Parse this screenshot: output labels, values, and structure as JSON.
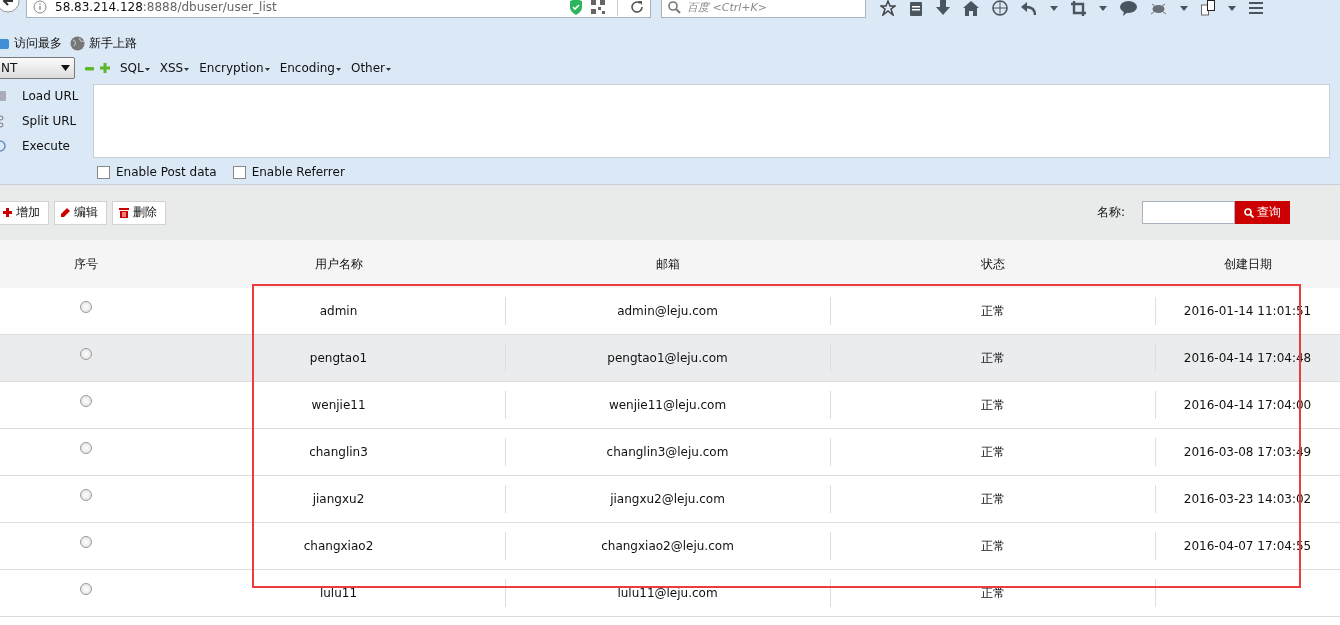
{
  "browser": {
    "url_host": "58.83.214.128",
    "url_rest": ":8888/dbuser/user_list",
    "search_placeholder": "百度 <Ctrl+K>"
  },
  "bookmarks": [
    {
      "label": "访问最多"
    },
    {
      "label": "新手上路"
    }
  ],
  "hackbar": {
    "select_value": "NT",
    "menus": [
      "SQL",
      "XSS",
      "Encryption",
      "Encoding",
      "Other"
    ],
    "actions": [
      {
        "label": "Load URL"
      },
      {
        "label": "Split URL"
      },
      {
        "label": "Execute"
      }
    ],
    "options": [
      {
        "label": "Enable Post data",
        "checked": false
      },
      {
        "label": "Enable Referrer",
        "checked": false
      }
    ]
  },
  "toolbar": {
    "buttons": [
      {
        "kind": "add",
        "label": "增加"
      },
      {
        "kind": "edit",
        "label": "编辑"
      },
      {
        "kind": "delete",
        "label": "删除"
      }
    ],
    "search_label": "名称:",
    "search_button": "查询"
  },
  "table": {
    "columns": [
      "序号",
      "用户名称",
      "邮箱",
      "状态",
      "创建日期"
    ],
    "rows": [
      {
        "selected": false,
        "name": "admin",
        "email": "admin@leju.com",
        "status": "正常",
        "created": "2016-01-14 11:01:51"
      },
      {
        "selected": false,
        "name": "pengtao1",
        "email": "pengtao1@leju.com",
        "status": "正常",
        "created": "2016-04-14 17:04:48"
      },
      {
        "selected": false,
        "name": "wenjie11",
        "email": "wenjie11@leju.com",
        "status": "正常",
        "created": "2016-04-14 17:04:00"
      },
      {
        "selected": false,
        "name": "changlin3",
        "email": "changlin3@leju.com",
        "status": "正常",
        "created": "2016-03-08 17:03:49"
      },
      {
        "selected": false,
        "name": "jiangxu2",
        "email": "jiangxu2@leju.com",
        "status": "正常",
        "created": "2016-03-23 14:03:02"
      },
      {
        "selected": false,
        "name": "changxiao2",
        "email": "changxiao2@leju.com",
        "status": "正常",
        "created": "2016-04-07 17:04:55"
      },
      {
        "selected": false,
        "name": "lulu11",
        "email": "lulu11@leju.com",
        "status": "正常"
      }
    ]
  },
  "highlight_box": true
}
